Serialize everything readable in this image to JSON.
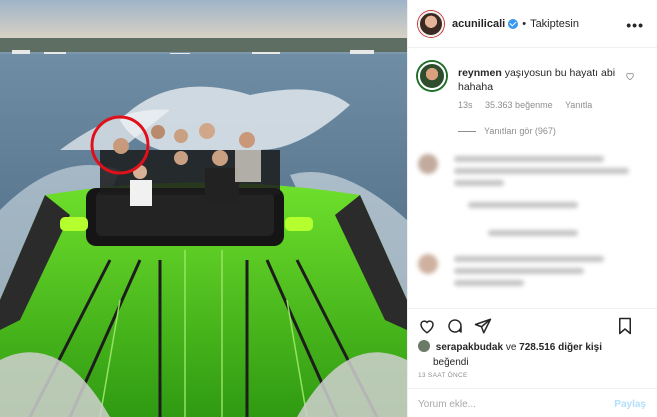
{
  "post": {
    "username": "acunilicali",
    "follow_status": "Takiptesin",
    "separator": "•",
    "more": "•••"
  },
  "comment": {
    "username": "reynmen",
    "text": "yaşıyosun bu hayatı abi hahaha",
    "time": "13s",
    "likes": "35.363 beğenme",
    "reply": "Yanıtla",
    "view_replies": "Yanıtları gör (967)"
  },
  "likes": {
    "user": "serapakbudak",
    "connector": "ve",
    "count": "728.516 diğer kişi",
    "suffix": "beğendi"
  },
  "timestamp": "13 SAAT ÖNCE",
  "add_comment": {
    "placeholder": "Yorum ekle...",
    "post_label": "Paylaş"
  },
  "icons": [
    "heart-icon",
    "comment-icon",
    "share-icon",
    "bookmark-icon",
    "verified-icon",
    "more-options-icon"
  ],
  "colors": {
    "verified": "#3897f0",
    "boat_green": "#56c81e",
    "highlight_circle": "#e0101a",
    "post_disabled": "#b2dffc"
  }
}
